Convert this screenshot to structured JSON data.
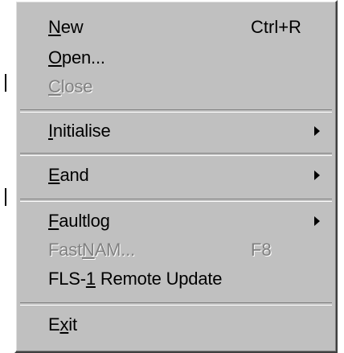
{
  "menu": {
    "items": [
      {
        "label_before": "",
        "mnemonic": "N",
        "label_after": "ew",
        "shortcut": "Ctrl+R"
      },
      {
        "label_before": "",
        "mnemonic": "O",
        "label_after": "pen...",
        "shortcut": ""
      },
      {
        "label_before": "",
        "mnemonic": "C",
        "label_after": "lose",
        "shortcut": ""
      },
      {
        "label_before": "",
        "mnemonic": "I",
        "label_after": "nitialise",
        "shortcut": ""
      },
      {
        "label_before": "",
        "mnemonic": "E",
        "label_after": "and",
        "shortcut": ""
      },
      {
        "label_before": "",
        "mnemonic": "F",
        "label_after": "aultlog",
        "shortcut": ""
      },
      {
        "label_before": "Fast",
        "mnemonic": "N",
        "label_after": "AM...",
        "shortcut": "F8"
      },
      {
        "label_before": "FLS-",
        "mnemonic": "1",
        "label_after": " Remote Update",
        "shortcut": ""
      },
      {
        "label_before": "E",
        "mnemonic": "x",
        "label_after": "it",
        "shortcut": ""
      }
    ]
  }
}
